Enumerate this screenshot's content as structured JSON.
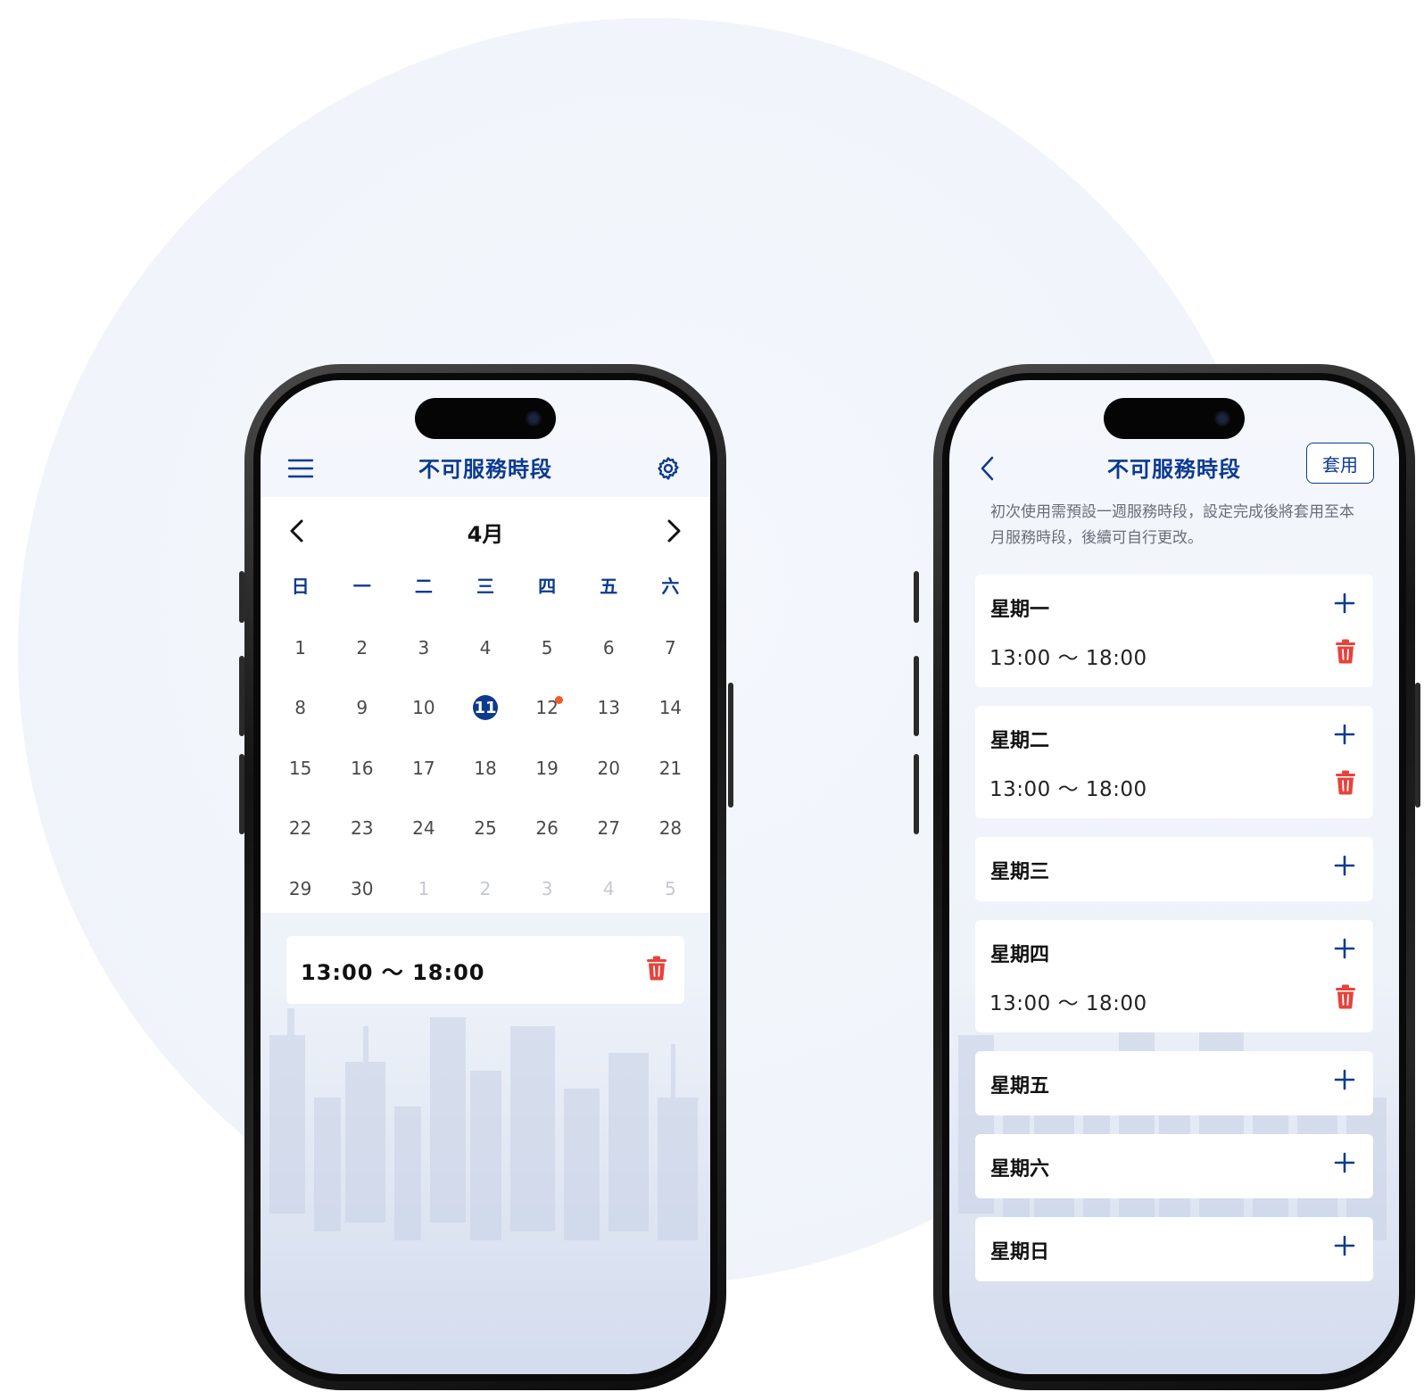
{
  "colors": {
    "primary": "#0c3a8f",
    "danger": "#e8423a",
    "dot": "#f05a28"
  },
  "left": {
    "title": "不可服務時段",
    "menu_icon": "menu-icon",
    "settings_icon": "gear-icon",
    "month": "4月",
    "weekdays": [
      "日",
      "一",
      "二",
      "三",
      "四",
      "五",
      "六"
    ],
    "days": [
      {
        "n": "1"
      },
      {
        "n": "2"
      },
      {
        "n": "3"
      },
      {
        "n": "4"
      },
      {
        "n": "5"
      },
      {
        "n": "6"
      },
      {
        "n": "7"
      },
      {
        "n": "8"
      },
      {
        "n": "9"
      },
      {
        "n": "10"
      },
      {
        "n": "11",
        "selected": true
      },
      {
        "n": "12",
        "dot": true
      },
      {
        "n": "13"
      },
      {
        "n": "14"
      },
      {
        "n": "15"
      },
      {
        "n": "16"
      },
      {
        "n": "17"
      },
      {
        "n": "18"
      },
      {
        "n": "19"
      },
      {
        "n": "20"
      },
      {
        "n": "21"
      },
      {
        "n": "22"
      },
      {
        "n": "23"
      },
      {
        "n": "24"
      },
      {
        "n": "25"
      },
      {
        "n": "26"
      },
      {
        "n": "27"
      },
      {
        "n": "28"
      },
      {
        "n": "29"
      },
      {
        "n": "30"
      },
      {
        "n": "1",
        "muted": true
      },
      {
        "n": "2",
        "muted": true
      },
      {
        "n": "3",
        "muted": true
      },
      {
        "n": "4",
        "muted": true
      },
      {
        "n": "5",
        "muted": true
      }
    ],
    "slot": "13:00 ～ 18:00"
  },
  "right": {
    "title": "不可服務時段",
    "back_icon": "chevron-left-icon",
    "apply_label": "套用",
    "notice": "初次使用需預設一週服務時段，設定完成後將套用至本月服務時段，後續可自行更改。",
    "week": [
      {
        "name": "星期一",
        "slots": [
          "13:00 ～ 18:00"
        ]
      },
      {
        "name": "星期二",
        "slots": [
          "13:00 ～ 18:00"
        ]
      },
      {
        "name": "星期三",
        "slots": []
      },
      {
        "name": "星期四",
        "slots": [
          "13:00 ～ 18:00"
        ]
      },
      {
        "name": "星期五",
        "slots": []
      },
      {
        "name": "星期六",
        "slots": []
      },
      {
        "name": "星期日",
        "slots": []
      }
    ]
  }
}
